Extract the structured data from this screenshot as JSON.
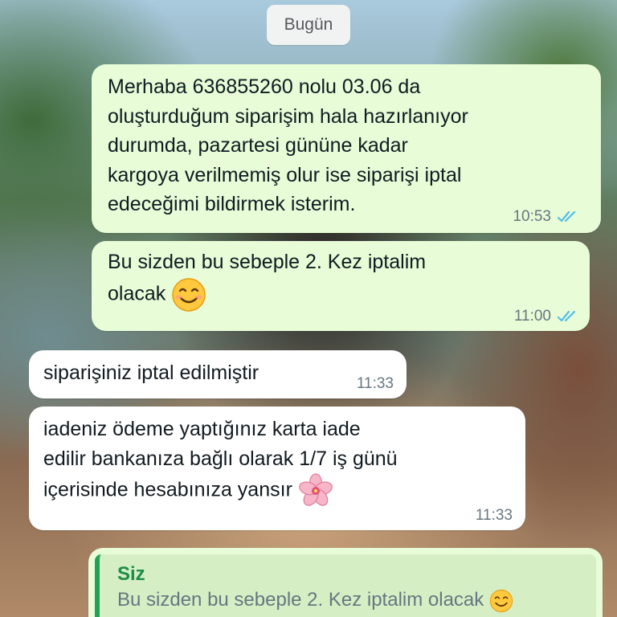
{
  "date_separator": "Bugün",
  "messages": [
    {
      "direction": "outgoing",
      "text": "Merhaba 636855260 nolu 03.06 da\noluşturduğum siparişim hala hazırlanıyor\ndurumda, pazartesi gününe kadar\nkargoya verilmemiş olur ise siparişi iptal\nedeceğimi bildirmek isterim.",
      "time": "10:53",
      "status": "read"
    },
    {
      "direction": "outgoing",
      "text": "Bu sizden bu sebeple 2. Kez iptalim\nolacak",
      "emoji": "smiling-face-icon",
      "time": "11:00",
      "status": "read"
    },
    {
      "direction": "incoming",
      "text": "siparişiniz iptal edilmiştir",
      "time": "11:33"
    },
    {
      "direction": "incoming",
      "text": "iadeniz ödeme yaptığınız karta iade\nedilir bankanıza bağlı olarak 1/7 iş günü\niçerisinde hesabınıza yansır",
      "emoji": "cherry-blossom-icon",
      "time": "11:33"
    }
  ],
  "reply_quote": {
    "author": "Siz",
    "text": "Bu sizden bu sebeple 2. Kez iptalim olacak",
    "emoji": "smiling-face-icon"
  },
  "colors": {
    "outgoing_bubble": "#e7fcd7",
    "incoming_bubble": "#ffffff",
    "read_check": "#53bdeb",
    "quote_accent": "#25a155"
  }
}
